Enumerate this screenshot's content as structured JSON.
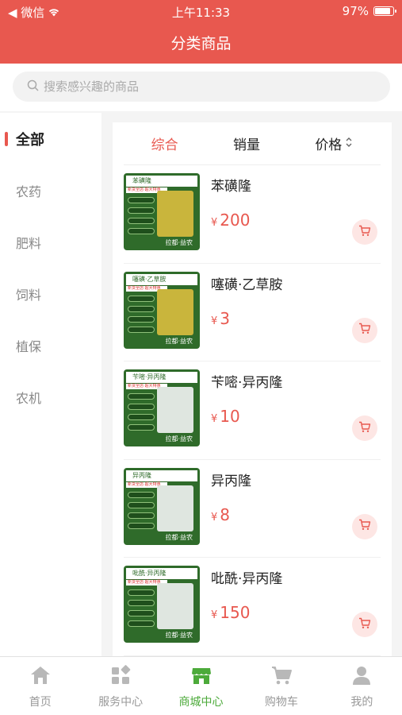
{
  "status_bar": {
    "back_label": "◀ 微信",
    "time": "上午11:33",
    "battery": "97%"
  },
  "header": {
    "title": "分类商品"
  },
  "search": {
    "placeholder": "搜索感兴趣的商品",
    "value": ""
  },
  "sidebar": {
    "items": [
      {
        "label": "全部",
        "active": true
      },
      {
        "label": "农药",
        "active": false
      },
      {
        "label": "肥料",
        "active": false
      },
      {
        "label": "饲料",
        "active": false
      },
      {
        "label": "植保",
        "active": false
      },
      {
        "label": "农机",
        "active": false
      }
    ]
  },
  "sort": {
    "items": [
      {
        "label": "综合",
        "active": true
      },
      {
        "label": "销量",
        "active": false
      },
      {
        "label": "价格",
        "active": false
      }
    ]
  },
  "products": [
    {
      "name": "苯磺隆",
      "currency": "¥",
      "price": "200",
      "thumb_title": "苯磺隆",
      "thumb_red": "新货全店·超大特惠",
      "thumb_bottom": "拉都·益农"
    },
    {
      "name": "噻磺·乙草胺",
      "currency": "¥",
      "price": "3",
      "thumb_title": "噻磺·乙草胺",
      "thumb_red": "新货全店·超大特惠",
      "thumb_bottom": "拉都·益农"
    },
    {
      "name": "苄嘧·异丙隆",
      "currency": "¥",
      "price": "10",
      "thumb_title": "苄嘧·异丙隆",
      "thumb_red": "新货全店·超大特惠",
      "thumb_bottom": "拉都·益农"
    },
    {
      "name": "异丙隆",
      "currency": "¥",
      "price": "8",
      "thumb_title": "异丙隆",
      "thumb_red": "新货全店·超大特惠",
      "thumb_bottom": "拉都·益农"
    },
    {
      "name": "吡酰·异丙隆",
      "currency": "¥",
      "price": "150",
      "thumb_title": "吡酰·异丙隆",
      "thumb_red": "新货全店·超大特惠",
      "thumb_bottom": "拉都·益农"
    }
  ],
  "tabbar": {
    "items": [
      {
        "label": "首页",
        "icon": "home-icon",
        "active": false
      },
      {
        "label": "服务中心",
        "icon": "grid-icon",
        "active": false
      },
      {
        "label": "商城中心",
        "icon": "store-icon",
        "active": true
      },
      {
        "label": "购物车",
        "icon": "cart-icon",
        "active": false
      },
      {
        "label": "我的",
        "icon": "user-icon",
        "active": false
      }
    ]
  },
  "colors": {
    "brand": "#e8584f",
    "tab_active": "#4caa3a"
  }
}
